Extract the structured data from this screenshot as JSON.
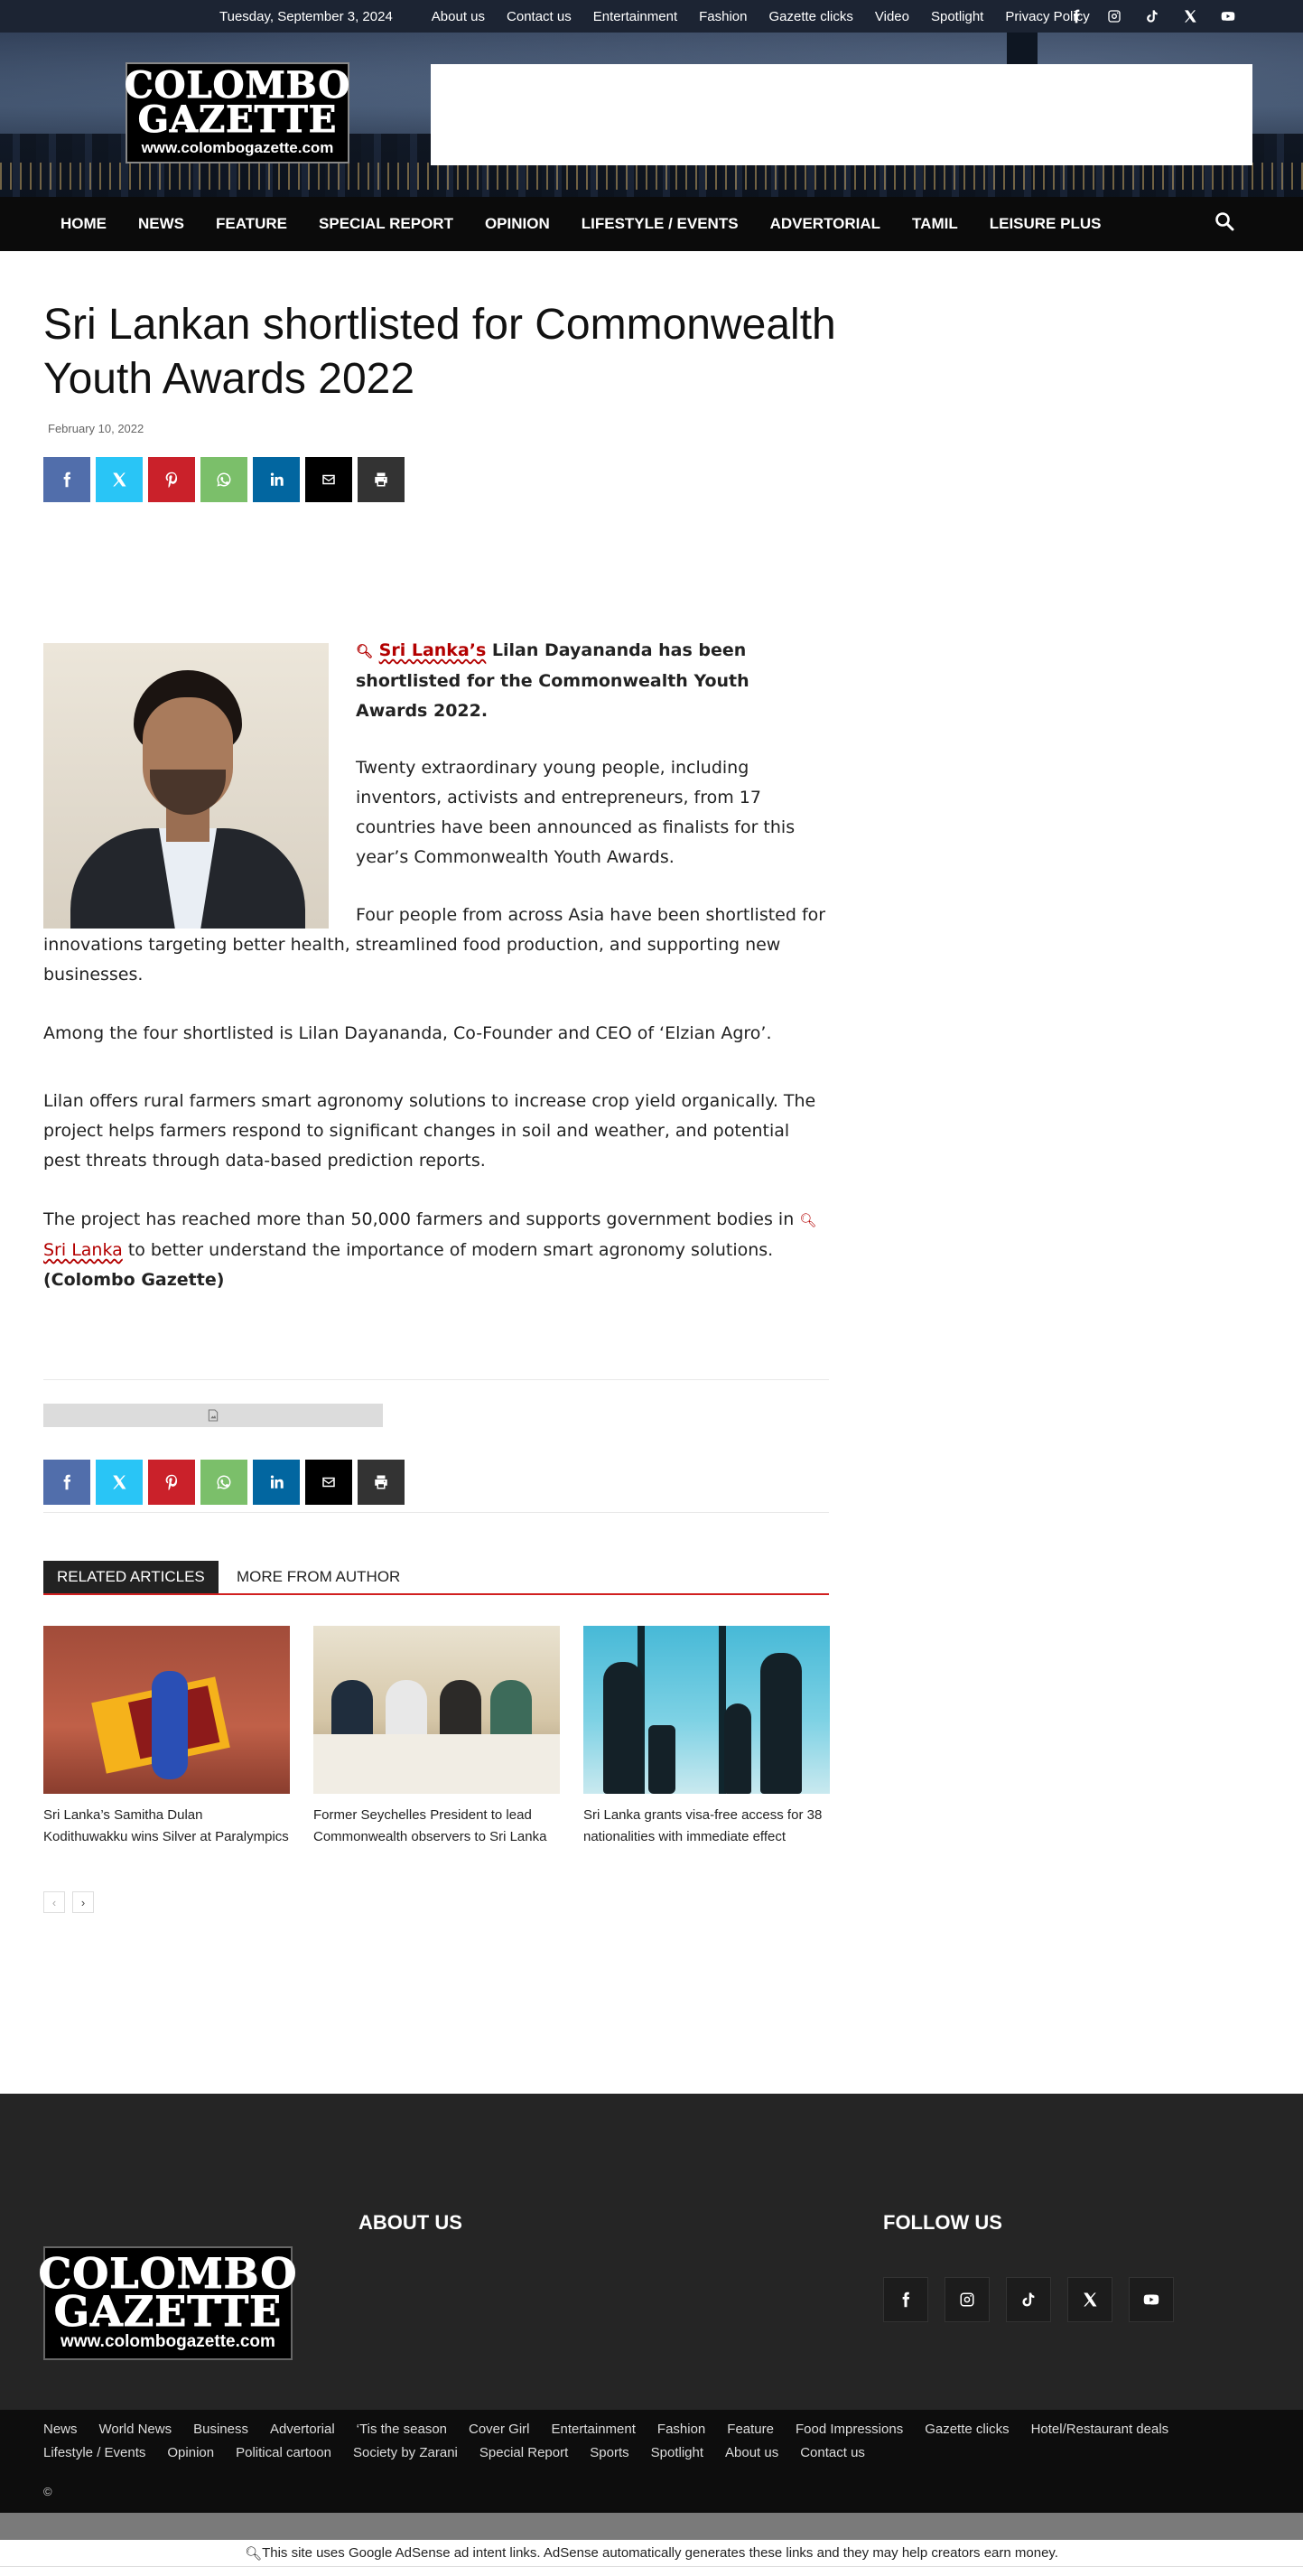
{
  "topbar": {
    "date": "Tuesday, September 3, 2024",
    "links": [
      "About us",
      "Contact us",
      "Entertainment",
      "Fashion",
      "Gazette clicks",
      "Video",
      "Spotlight",
      "Privacy Policy"
    ],
    "social_icons": [
      "facebook-icon",
      "instagram-icon",
      "tiktok-icon",
      "x-icon",
      "youtube-icon"
    ]
  },
  "logo": {
    "line1": "COLOMBO",
    "line2": "GAZETTE",
    "line3": "www.colombogazette.com"
  },
  "nav": {
    "items": [
      "HOME",
      "NEWS",
      "FEATURE",
      "SPECIAL REPORT",
      "OPINION",
      "LIFESTYLE / EVENTS",
      "ADVERTORIAL",
      "TAMIL",
      "LEISURE PLUS"
    ],
    "search_icon": "search-icon"
  },
  "article": {
    "title": "Sri Lankan shortlisted for Commonwealth Youth Awards 2022",
    "date": "February 10, 2022",
    "lead_link": "Sri Lanka’s",
    "lead_rest": " Lilan Dayananda has been shortlisted for the Commonwealth Youth Awards 2022.",
    "p2": "Twenty extraordinary young people, including inventors, activists and entrepreneurs, from 17 countries have been announced as finalists for this year’s Commonwealth Youth Awards.",
    "p3": "Four people from across Asia have been shortlisted for innovations targeting better health, streamlined food production, and supporting new businesses.",
    "p4": "Among the four shortlisted is Lilan Dayananda, Co-Founder and CEO of ‘Elzian Agro’.",
    "p5": "Lilan offers rural farmers smart agronomy solutions to increase crop yield organically. The project helps farmers respond to significant changes in soil and weather, and potential pest threats through data-based prediction reports.",
    "p6_before": "The project has reached more than 50,000 farmers and supports government bodies in ",
    "p6_link": "Sri Lanka",
    "p6_after": " to better understand the importance of modern smart agronomy solutions.",
    "source": "(Colombo Gazette)"
  },
  "share_buttons": [
    "facebook",
    "x",
    "pinterest",
    "whatsapp",
    "linkedin",
    "email",
    "print"
  ],
  "related": {
    "tab_active": "RELATED ARTICLES",
    "tab_other": "MORE FROM AUTHOR",
    "items": [
      {
        "caption": "Sri Lanka’s Samitha Dulan Kodithuwakku wins Silver at Paralympics"
      },
      {
        "caption": "Former Seychelles President to lead Commonwealth observers to Sri Lanka"
      },
      {
        "caption": "Sri Lanka grants visa-free access for 38 nationalities with immediate effect"
      }
    ],
    "pager_prev": "‹",
    "pager_next": "›"
  },
  "footer": {
    "about_heading": "ABOUT US",
    "follow_heading": "FOLLOW US",
    "links_row1": [
      "News",
      "World News",
      "Business",
      "Advertorial",
      "‘Tis the season",
      "Cover Girl",
      "Entertainment",
      "Fashion",
      "Feature",
      "Food Impressions",
      "Gazette clicks",
      "Hotel/Restaurant deals"
    ],
    "links_row2": [
      "Lifestyle / Events",
      "Opinion",
      "Political cartoon",
      "Society by Zarani",
      "Special Report",
      "Sports",
      "Spotlight",
      "About us",
      "Contact us"
    ],
    "copyright": "©"
  },
  "adsense_notice": "This site uses Google AdSense ad intent links. AdSense automatically generates these links and they may help creators earn money.",
  "colors": {
    "topbar": "#1c2433",
    "nav": "#0b0b0b",
    "accent_red": "#d11f1f",
    "footer": "#252525",
    "subfooter": "#0d0d0d"
  }
}
